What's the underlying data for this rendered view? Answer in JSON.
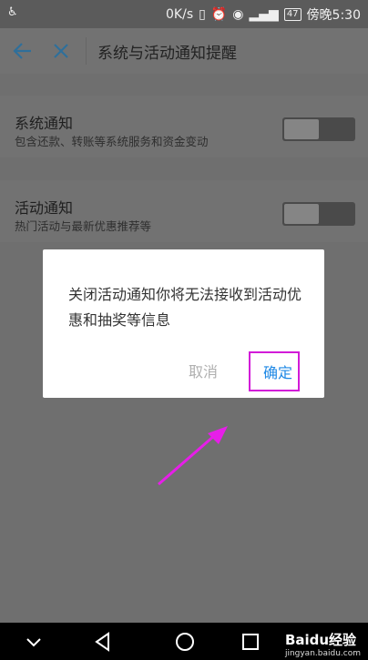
{
  "status_bar": {
    "left_icon": "accessibility-icon",
    "net_speed": "0K/s",
    "battery": "47",
    "time": "傍晚5:30"
  },
  "header": {
    "title": "系统与活动通知提醒",
    "back_icon": "arrow-left-icon",
    "close_icon": "close-icon",
    "accent_color": "#2f6f9a"
  },
  "settings": [
    {
      "title": "系统通知",
      "subtitle": "包含还款、转账等系统服务和资金变动",
      "enabled": false
    },
    {
      "title": "活动通知",
      "subtitle": "热门活动与最新优惠推荐等",
      "enabled": false
    }
  ],
  "dialog": {
    "message": "关闭活动通知你将无法接收到活动优惠和抽奖等信息",
    "cancel_label": "取消",
    "confirm_label": "确定",
    "confirm_color": "#1e88e5",
    "highlight_color": "#d21bd8"
  },
  "nav_bar": {
    "watermark_text": "Baidu经验",
    "watermark_sub": "jingyan.baidu.com"
  }
}
